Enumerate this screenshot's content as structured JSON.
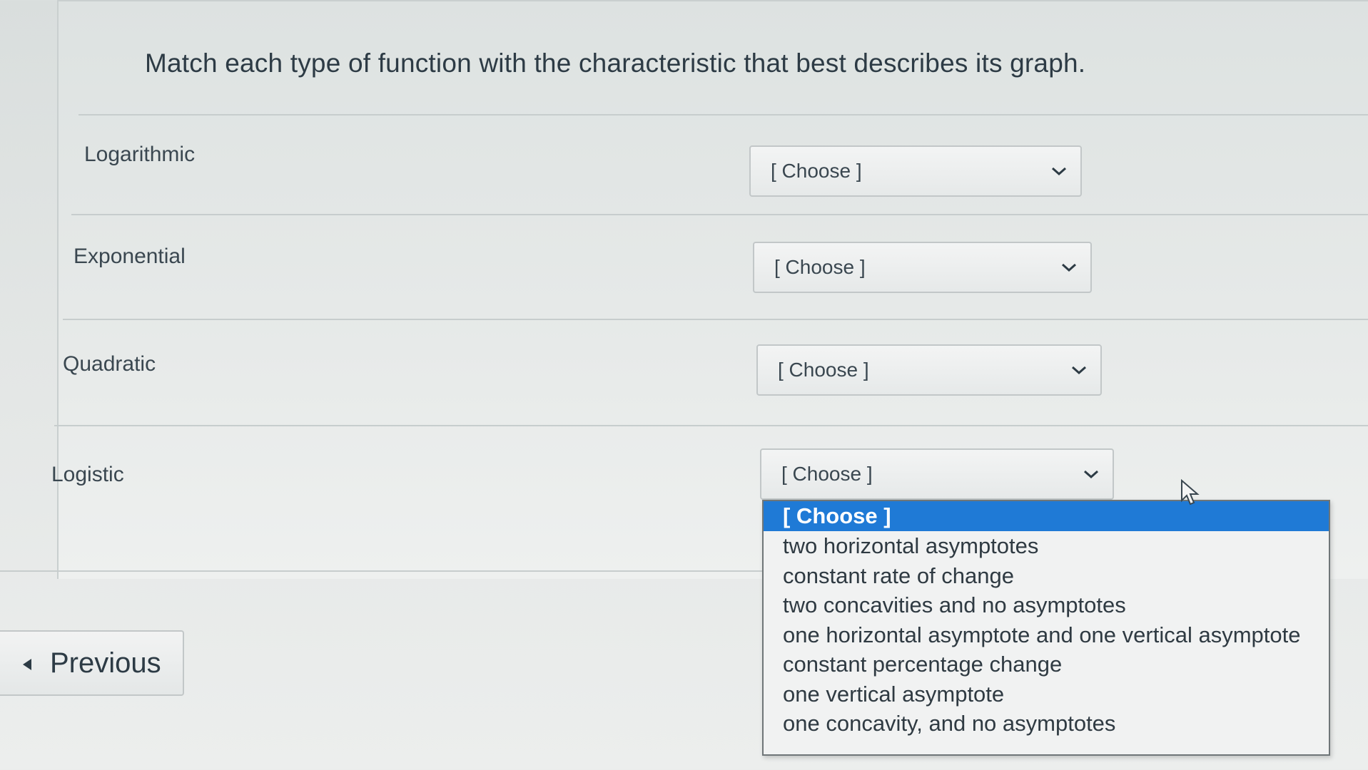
{
  "question": {
    "text": "Match each type of function with the characteristic that best describes its graph."
  },
  "rows": [
    {
      "label": "Logarithmic",
      "selected": "[ Choose ]"
    },
    {
      "label": "Exponential",
      "selected": "[ Choose ]"
    },
    {
      "label": "Quadratic",
      "selected": "[ Choose ]"
    },
    {
      "label": "Logistic",
      "selected": "[ Choose ]"
    }
  ],
  "dropdown": {
    "options": [
      "[ Choose ]",
      "two horizontal asymptotes",
      "constant rate of change",
      "two concavities and no asymptotes",
      "one horizontal asymptote and one vertical asymptote",
      "constant percentage change",
      "one vertical asymptote",
      "one concavity, and no asymptotes"
    ],
    "highlighted": "[ Choose ]"
  },
  "navigation": {
    "previous_label": "Previous"
  },
  "colors": {
    "highlight": "#1f7ad6",
    "text": "#2d3b45"
  }
}
